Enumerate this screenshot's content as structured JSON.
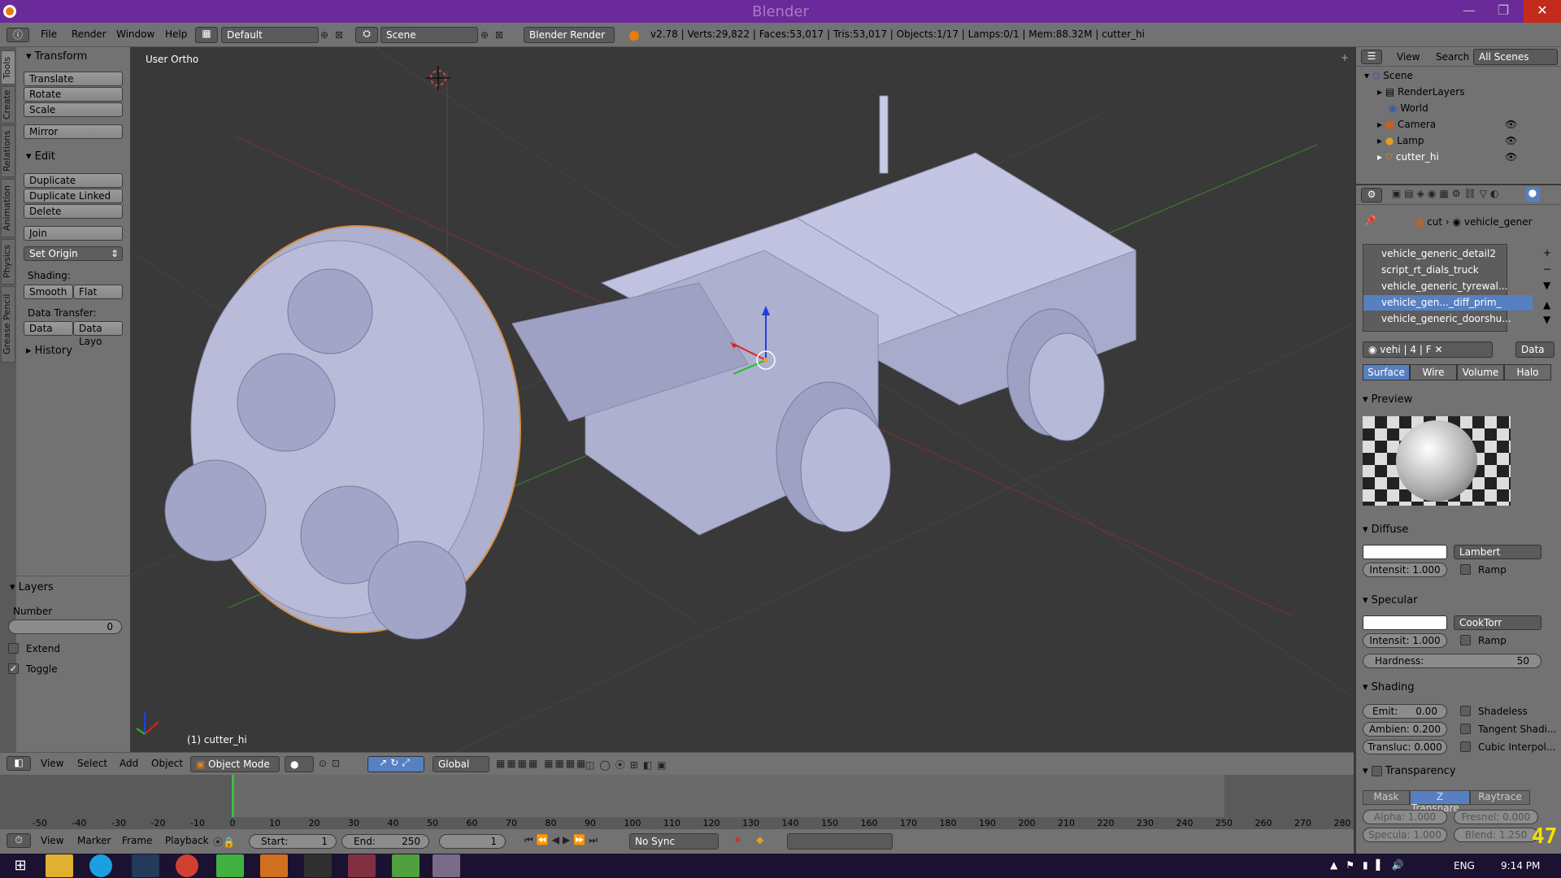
{
  "window": {
    "title": "Blender",
    "min": "—",
    "max": "❐",
    "close": "✕"
  },
  "menubar": {
    "menus": [
      "File",
      "Render",
      "Window",
      "Help"
    ],
    "layout": "Default",
    "scene": "Scene",
    "engine": "Blender Render",
    "stats": "v2.78 | Verts:29,822 | Faces:53,017 | Tris:53,017 | Objects:1/17 | Lamps:0/1 | Mem:88.32M | cutter_hi"
  },
  "tooltabs": [
    "Tools",
    "Create",
    "Relations",
    "Animation",
    "Physics",
    "Grease Pencil"
  ],
  "toolshelf": {
    "transform_header": "Transform",
    "translate": "Translate",
    "rotate": "Rotate",
    "scale": "Scale",
    "mirror": "Mirror",
    "edit_header": "Edit",
    "duplicate": "Duplicate",
    "duplicate_linked": "Duplicate Linked",
    "delete": "Delete",
    "join": "Join",
    "set_origin": "Set Origin",
    "shading_label": "Shading:",
    "smooth": "Smooth",
    "flat": "Flat",
    "data_transfer_label": "Data Transfer:",
    "data": "Data",
    "data_layout": "Data Layo",
    "history_header": "History",
    "layers_header": "Layers",
    "number_label": "Number",
    "number_value": "0",
    "extend": "Extend",
    "toggle": "Toggle",
    "extend_checked": false,
    "toggle_checked": true
  },
  "viewport": {
    "view_label": "User Ortho",
    "object_label": "(1) cutter_hi"
  },
  "outliner": {
    "view": "View",
    "search": "Search",
    "filter": "All Scenes",
    "items": [
      "Scene",
      "RenderLayers",
      "World",
      "Camera",
      "Lamp",
      "cutter_hi"
    ]
  },
  "properties": {
    "breadcrumb": [
      "cut",
      "vehicle_gener"
    ],
    "slots": [
      "vehicle_generic_detail2",
      "script_rt_dials_truck",
      "vehicle_generic_tyrewal...",
      "vehicle_gen..._diff_prim_",
      "vehicle_generic_doorshu..."
    ],
    "selected_slot": 3,
    "mat_name": "vehi",
    "users": "4",
    "fake": "F",
    "data_dropdown": "Data",
    "tabs": [
      "Surface",
      "Wire",
      "Volume",
      "Halo"
    ],
    "preview_header": "Preview",
    "diffuse_header": "Diffuse",
    "diffuse_shader": "Lambert",
    "diffuse_intensity": "Intensit: 1.000",
    "ramp": "Ramp",
    "specular_header": "Specular",
    "specular_shader": "CookTorr",
    "specular_intensity": "Intensit: 1.000",
    "hardness": "Hardness:",
    "hardness_value": "50",
    "shading_header": "Shading",
    "emit": "Emit:",
    "emit_value": "0.00",
    "ambient": "Ambien: 0.200",
    "translucency": "Transluc: 0.000",
    "shadeless": "Shadeless",
    "tangent": "Tangent Shadi...",
    "cubic": "Cubic Interpol...",
    "transparency_header": "Transparency",
    "mask": "Mask",
    "ztransp": "Z Transpare...",
    "raytrace": "Raytrace",
    "alpha": "Alpha: 1.000",
    "fresnel": "Fresnel: 0.000",
    "specula": "Specula: 1.000",
    "blend": "Blend: 1.250"
  },
  "viewport_header": {
    "menus": [
      "View",
      "Select",
      "Add",
      "Object"
    ],
    "mode": "Object Mode",
    "orientation": "Global"
  },
  "timeline": {
    "ticks": [
      "-50",
      "-40",
      "-30",
      "-20",
      "-10",
      "0",
      "10",
      "20",
      "30",
      "40",
      "50",
      "60",
      "70",
      "80",
      "90",
      "100",
      "110",
      "120",
      "130",
      "140",
      "150",
      "160",
      "170",
      "180",
      "190",
      "200",
      "210",
      "220",
      "230",
      "240",
      "250",
      "260",
      "270",
      "280"
    ],
    "menus": [
      "View",
      "Marker",
      "Frame",
      "Playback"
    ],
    "start": "Start:",
    "start_value": "1",
    "end": "End:",
    "end_value": "250",
    "current": "1",
    "sync": "No Sync"
  },
  "fps_overlay": "47",
  "taskbar": {
    "lang": "ENG",
    "time": "9:14 PM"
  }
}
